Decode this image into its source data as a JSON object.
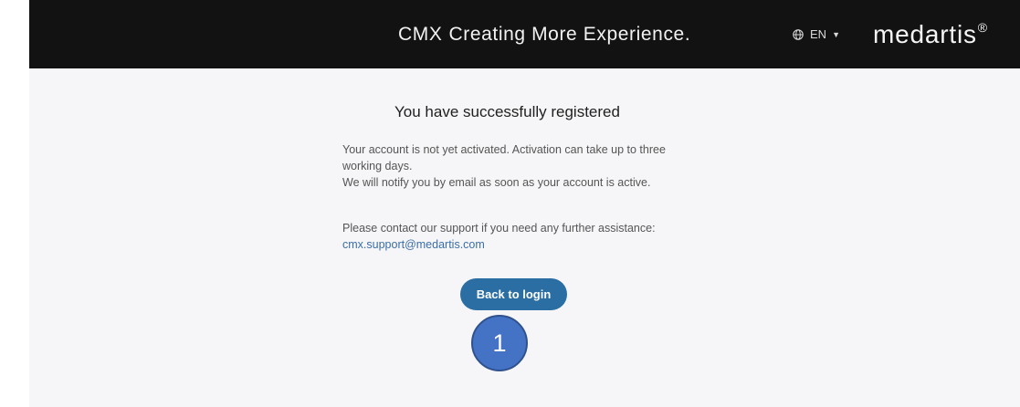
{
  "header": {
    "brand_prefix": "CMX",
    "brand_tagline": "Creating More Experience.",
    "language": {
      "icon": "globe-icon",
      "code": "EN",
      "caret": "▼"
    },
    "logo_text": "medartis",
    "logo_mark": "®"
  },
  "main": {
    "heading": "You have successfully registered",
    "message_lines": [
      "Your account is not yet activated. Activation can take up to three working days.",
      "We will notify you by email as soon as your account is active."
    ],
    "support_text": "Please contact our support if you need any further assistance:",
    "support_email": "cmx.support@medartis.com",
    "back_button_label": "Back to login",
    "step_marker": "1"
  },
  "colors": {
    "header_bg": "#121212",
    "content_bg": "#f6f6f8",
    "button_bg": "#2b6ea3",
    "link": "#3b6ea5",
    "marker_bg": "#4472c4"
  }
}
